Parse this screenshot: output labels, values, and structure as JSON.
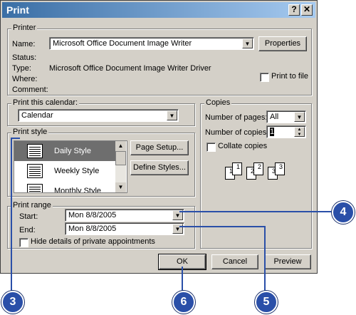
{
  "window": {
    "title": "Print",
    "help_btn": "?",
    "close_btn": "✕"
  },
  "printer": {
    "legend": "Printer",
    "name_label": "Name:",
    "name_value": "Microsoft Office Document Image Writer",
    "properties": "Properties",
    "status_label": "Status:",
    "type_label": "Type:",
    "type_value": "Microsoft Office Document Image Writer Driver",
    "where_label": "Where:",
    "comment_label": "Comment:",
    "print_to_file": "Print to file"
  },
  "calendar": {
    "legend": "Print this calendar:",
    "value": "Calendar"
  },
  "style": {
    "legend": "Print style",
    "items": [
      "Daily Style",
      "Weekly Style",
      "Monthly Style"
    ],
    "page_setup": "Page Setup...",
    "define_styles": "Define Styles..."
  },
  "range": {
    "legend": "Print range",
    "start_label": "Start:",
    "start_value": "Mon 8/8/2005",
    "end_label": "End:",
    "end_value": "Mon 8/8/2005",
    "hide_private": "Hide details of private appointments"
  },
  "copies": {
    "legend": "Copies",
    "pages_label": "Number of pages:",
    "pages_value": "All",
    "copies_label": "Number of copies:",
    "copies_value": "1",
    "collate": "Collate copies",
    "collate_pages": [
      "1",
      "1",
      "2",
      "2",
      "3",
      "3"
    ]
  },
  "buttons": {
    "ok": "OK",
    "cancel": "Cancel",
    "preview": "Preview"
  },
  "callouts": [
    "3",
    "4",
    "5",
    "6"
  ],
  "colors": {
    "titlebar": "#3a6ea5",
    "callout": "#2a4fa8",
    "selection": "#6e6e6e"
  }
}
